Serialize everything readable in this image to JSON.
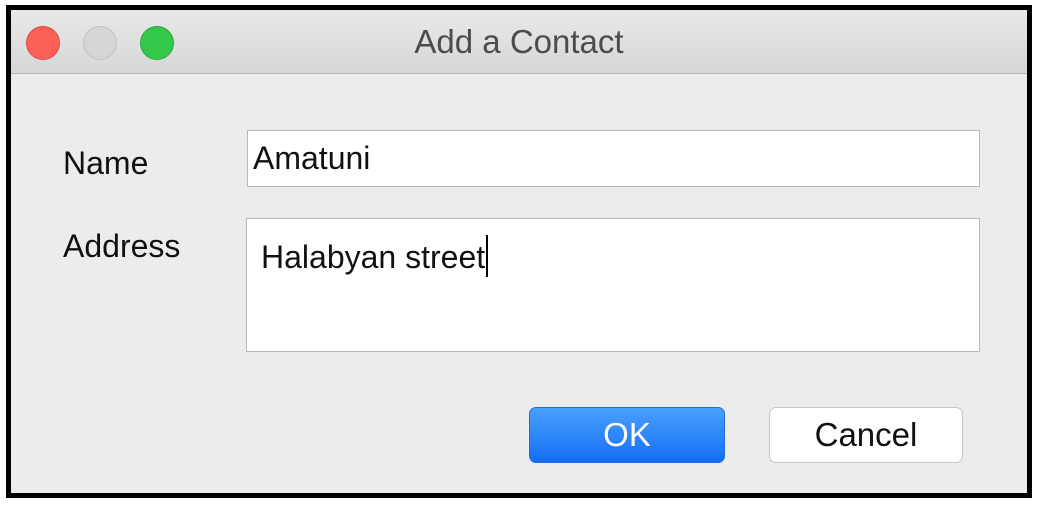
{
  "window": {
    "title": "Add a Contact",
    "traffic_lights": {
      "close_color": "#fc5f57",
      "minimize_color": "#d5d5d5",
      "zoom_color": "#34c84a"
    }
  },
  "form": {
    "name_label": "Name",
    "name_value": "Amatuni",
    "address_label": "Address",
    "address_value": "Halabyan street"
  },
  "buttons": {
    "ok_label": "OK",
    "cancel_label": "Cancel",
    "accent_color": "#136ef5"
  }
}
